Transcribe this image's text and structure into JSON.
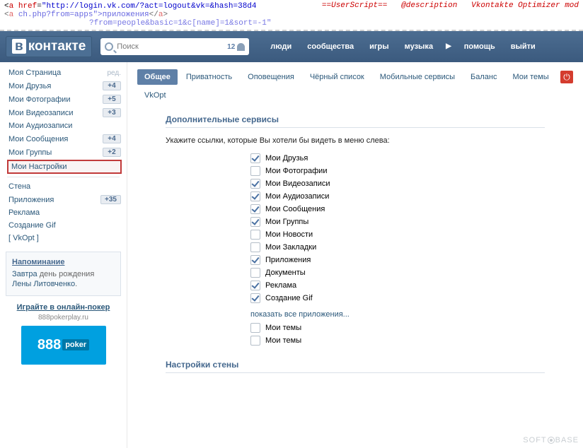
{
  "torn": {
    "href": "http://login.vk.com/?act=logout&vk=&hash=38d4",
    "l2a": "ch.php?from=apps\">приложения",
    "l3a": "?from=people&basic=1&c[name]=1&sort=-1\"",
    "us": "==UserScript==",
    "desc": "@description",
    "opt": "Vkontakte Optimizer mod"
  },
  "brand": "контакте",
  "search": {
    "placeholder": "Поиск",
    "count": "12"
  },
  "nav": {
    "people": "люди",
    "comm": "сообщества",
    "games": "игры",
    "music": "музыка",
    "help": "помощь",
    "exit": "выйти"
  },
  "side": {
    "edit": "ред.",
    "items": [
      {
        "label": "Моя Страница",
        "edit": true
      },
      {
        "label": "Мои Друзья",
        "badge": "+4"
      },
      {
        "label": "Мои Фотографии",
        "badge": "+5"
      },
      {
        "label": "Мои Видеозаписи",
        "badge": "+3"
      },
      {
        "label": "Мои Аудиозаписи"
      },
      {
        "label": "Мои Сообщения",
        "badge": "+4"
      },
      {
        "label": "Мои Группы",
        "badge": "+2"
      },
      {
        "label": "Мои Настройки",
        "hl": true
      }
    ],
    "items2": [
      {
        "label": "Стена"
      },
      {
        "label": "Приложения",
        "badge": "+35"
      },
      {
        "label": "Реклама"
      },
      {
        "label": "Создание Gif"
      },
      {
        "label": "[ VkOpt ]"
      }
    ]
  },
  "remind": {
    "title": "Напоминание",
    "body_pre": "Завтра",
    "body_mid": " день рождения ",
    "link": "Лены Литовченко",
    "body_post": "."
  },
  "ad": {
    "title": "Играйте в онлайн-покер",
    "sub": "888pokerplay.ru",
    "brand": "888",
    "tag": "poker"
  },
  "tabs": [
    "Общее",
    "Приватность",
    "Оповещения",
    "Чёрный список",
    "Мобильные сервисы",
    "Баланс",
    "Мои темы",
    "VkOpt"
  ],
  "section1": "Дополнительные сервисы",
  "hint": "Укажите ссылки, которые Вы хотели бы видеть в меню слева:",
  "checks": [
    {
      "label": "Мои Друзья",
      "on": true
    },
    {
      "label": "Мои Фотографии",
      "on": false
    },
    {
      "label": "Мои Видеозаписи",
      "on": true
    },
    {
      "label": "Мои Аудиозаписи",
      "on": true
    },
    {
      "label": "Мои Сообщения",
      "on": true
    },
    {
      "label": "Мои Группы",
      "on": true
    },
    {
      "label": "Мои Новости",
      "on": false
    },
    {
      "label": "Мои Закладки",
      "on": false
    },
    {
      "label": "Приложения",
      "on": true
    },
    {
      "label": "Документы",
      "on": false
    },
    {
      "label": "Реклама",
      "on": true
    },
    {
      "label": "Создание Gif",
      "on": true
    }
  ],
  "showall": "показать все приложения...",
  "checks2": [
    {
      "label": "Мои темы",
      "on": false
    },
    {
      "label": "Мои темы",
      "on": false
    }
  ],
  "section2": "Настройки стены",
  "watermark": {
    "a": "SOFT",
    "b": "BASE"
  }
}
